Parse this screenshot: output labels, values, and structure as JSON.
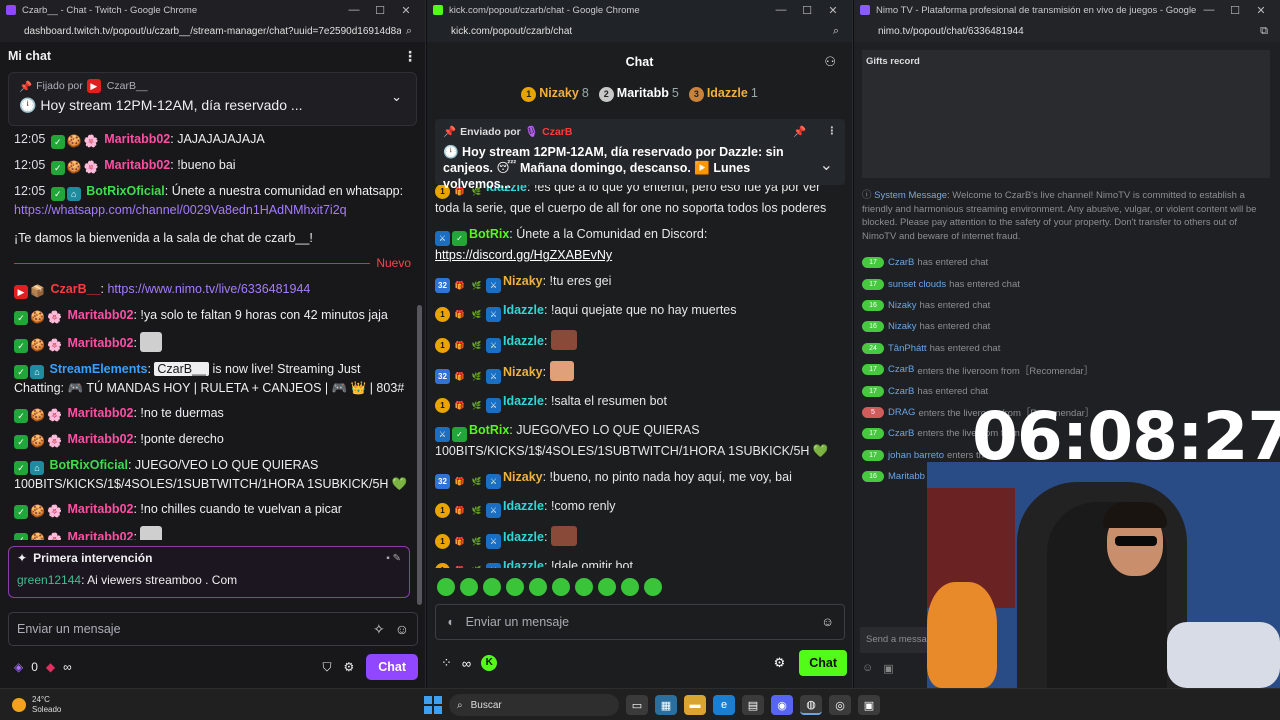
{
  "twitch": {
    "title": "Czarb__ - Chat - Twitch - Google Chrome",
    "url": "dashboard.twitch.tv/popout/u/czarb__/stream-manager/chat?uuid=7e2590d16914d8a5...",
    "header": "Mi chat",
    "pinned_by": "Fijado por",
    "pinned_user": "CzarB__",
    "pinned_msg": "Hoy stream 12PM-12AM, día reservado ...",
    "messages": [
      {
        "time": "12:05",
        "user": "Maritabb02",
        "text": ": JAJAJAJAJAJA"
      },
      {
        "time": "12:05",
        "user": "Maritabb02",
        "text": ": !bueno bai"
      },
      {
        "time": "12:05",
        "user": "BotRixOficial",
        "text": ": Únete a nuestra comunidad en whatsapp:",
        "link": "https://whatsapp.com/channel/0029Va8edn1HAdNMhxit7i2q"
      }
    ],
    "welcome": "¡Te damos la bienvenida a la sala de chat de czarb__!",
    "new_label": "Nuevo",
    "after": [
      {
        "user": "CzarB__",
        "text": ": ",
        "link": "https://www.nimo.tv/live/6336481944"
      },
      {
        "user": "Maritabb02",
        "text": ": !ya solo te faltan 9 horas con 42 minutos jaja"
      },
      {
        "user": "Maritabb02",
        "text": ":"
      },
      {
        "user": "StreamElements",
        "chip": "CzarB__",
        "text": " is now live! Streaming Just Chatting: 🎮 TÚ MANDAS HOY | RULETA + CANJEOS | 🎮 👑 | 803#"
      },
      {
        "user": "Maritabb02",
        "text": ": !no te duermas"
      },
      {
        "user": "Maritabb02",
        "text": ": !ponte derecho"
      },
      {
        "user": "BotRixOficial",
        "text": ": JUEGO/VEO LO QUE QUIERAS 100BITS/KICKS/1$/4SOLES/1SUBTWITCH/1HORA 1SUBKICK/5H 💚"
      },
      {
        "user": "Maritabb02",
        "text": ": !no chilles cuando te vuelvan a picar"
      },
      {
        "user": "Maritabb02",
        "text": ":"
      }
    ],
    "first_title": "Primera intervención",
    "first_user": "green12144",
    "first_text": ": Ai viewers streamboo . Com",
    "input_placeholder": "Enviar un mensaje",
    "points": "0",
    "infinity": "∞",
    "chat_button": "Chat"
  },
  "kick": {
    "title": "kick.com/popout/czarb/chat - Google Chrome",
    "url": "kick.com/popout/czarb/chat",
    "header": "Chat",
    "leaders": [
      {
        "rank": "1",
        "name": "Nizaky",
        "count": "8",
        "color": "#f0b040"
      },
      {
        "rank": "2",
        "name": "Maritabb",
        "count": "5",
        "color": "#ffffff"
      },
      {
        "rank": "3",
        "name": "Idazzle",
        "count": "1",
        "color": "#f0b040"
      }
    ],
    "pinned_label": "Enviado por",
    "pinned_user": "CzarB",
    "pinned_msg": "🕛 Hoy stream 12PM-12AM, día reservado por Dazzle: sin canjeos. 😴 Mañana domingo, descanso. ▶️ Lunes volvemos...",
    "messages": [
      {
        "user": "Idazzle",
        "text": ": !es que a lo que yo entendí, pero eso fue ya por ver toda la serie, que el cuerpo de all for one no soporta todos los poderes",
        "cls": "ku-teal"
      },
      {
        "user": "BotRix",
        "text": ": Únete a la Comunidad en Discord:",
        "link": "https://discord.gg/HgZXABEvNy",
        "cls": "ku-green"
      },
      {
        "user": "Nizaky",
        "text": ": !tu eres gei",
        "cls": "ku-orange"
      },
      {
        "user": "Idazzle",
        "text": ": !aqui quejate que no hay muertes",
        "cls": "ku-teal"
      },
      {
        "user": "Idazzle",
        "text": ":",
        "cls": "ku-teal"
      },
      {
        "user": "Nizaky",
        "text": ":",
        "cls": "ku-orange"
      },
      {
        "user": "Idazzle",
        "text": ": !salta el resumen bot",
        "cls": "ku-teal"
      },
      {
        "user": "BotRix",
        "text": ": JUEGO/VEO LO QUE QUIERAS 100BITS/KICKS/1$/4SOLES/1SUBTWITCH/1HORA 1SUBKICK/5H 💚",
        "cls": "ku-green"
      },
      {
        "user": "Nizaky",
        "text": ": !bueno, no pinto nada hoy aquí, me voy, bai",
        "cls": "ku-orange"
      },
      {
        "user": "Idazzle",
        "text": ": !como renly",
        "cls": "ku-teal"
      },
      {
        "user": "Idazzle",
        "text": ":",
        "cls": "ku-teal"
      },
      {
        "user": "Idazzle",
        "text": ": !dale omitir bot",
        "cls": "ku-teal"
      }
    ],
    "input_placeholder": "Enviar un mensaje",
    "chat_button": "Chat"
  },
  "nimo": {
    "title": "Nimo TV - Plataforma profesional de transmisión en vivo de juegos - Google Chrome",
    "url": "nimo.tv/popout/chat/6336481944",
    "gifts": "Gifts record",
    "sys_label": "System Message:",
    "sys_text": " Welcome to CzarB's live channel! NimoTV is committed to establish a friendly and harmonious streaming environment. Any abusive, vulgar, or violent content will be blocked. Please pay attention to the safety of your property. Don't transfer to others out of NimoTV and beware of internet fraud.",
    "rows": [
      {
        "lv": "17",
        "name": "CzarB",
        "text": "has entered chat"
      },
      {
        "lv": "17",
        "name": "sunset clouds",
        "text": "has entered chat"
      },
      {
        "lv": "16",
        "name": "Nizaky",
        "text": "has entered chat"
      },
      {
        "lv": "16",
        "name": "Nizaky",
        "text": "has entered chat"
      },
      {
        "lv": "24",
        "name": "TânPhátt",
        "text": "has entered chat"
      },
      {
        "lv": "17",
        "name": "CzarB",
        "text": "enters the liveroom from［Recomendar］"
      },
      {
        "lv": "17",
        "name": "CzarB",
        "text": "has entered chat"
      },
      {
        "lv": "5",
        "name": "DRAG",
        "text": "enters the liveroom from［Recomendar］"
      },
      {
        "lv": "17",
        "name": "CzarB",
        "text": "enters the liveroom from"
      },
      {
        "lv": "17",
        "name": "johan barreto",
        "text": "enters the"
      },
      {
        "lv": "16",
        "name": "Maritabb",
        "text": ""
      }
    ],
    "input_placeholder": "Send a message",
    "clock": "06:08:27"
  },
  "taskbar": {
    "temp": "24°C",
    "weather": "Soleado",
    "search": "Buscar"
  },
  "colors": {
    "twitch_purple": "#9146ff",
    "kick_green": "#53fc18"
  }
}
